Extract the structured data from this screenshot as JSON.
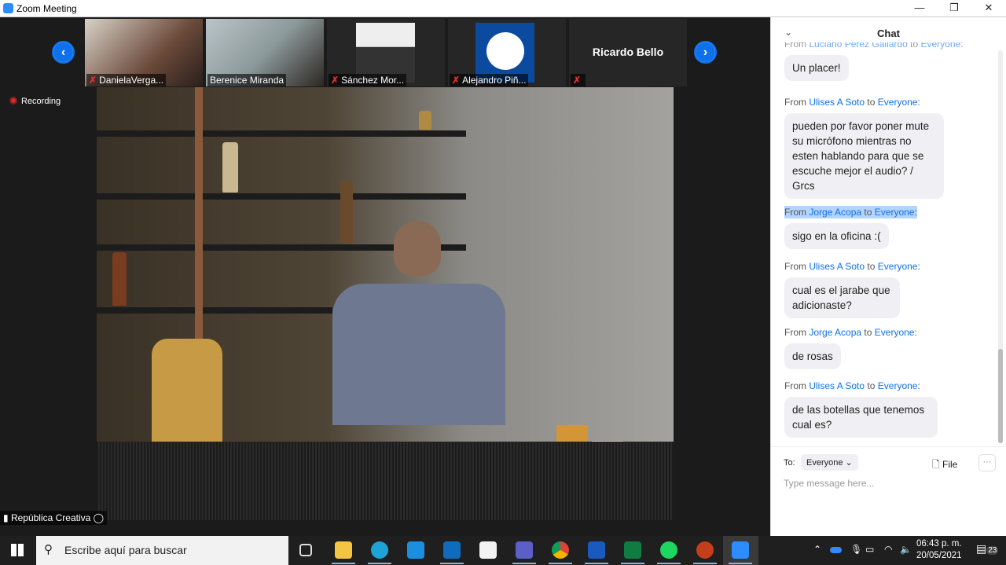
{
  "window": {
    "title": "Zoom Meeting",
    "minimize": "—",
    "restore": "❐",
    "close": "✕"
  },
  "gallery": {
    "participants": [
      {
        "name": "DanielaVerga...",
        "muted": true
      },
      {
        "name": "Berenice Miranda",
        "muted": false
      },
      {
        "name": "Sánchez Mor...",
        "muted": true
      },
      {
        "name": "Alejandro Piñ...",
        "muted": true
      },
      {
        "name": "",
        "display_name": "Ricardo Bello",
        "muted": true
      }
    ],
    "prev": "‹",
    "next": "›"
  },
  "recording": "Recording",
  "active_speaker": "República Creativa",
  "chat": {
    "title": "Chat",
    "collapse": "⌄",
    "messages": [
      {
        "from": "Luciano Pérez Gallardo",
        "to": "Everyone",
        "text": "Un placer!",
        "selected": false
      },
      {
        "from": "Ulises A Soto",
        "to": "Everyone",
        "text": "pueden por favor poner mute su micrófono mientras no esten hablando para que se escuche mejor el audio? / Grcs",
        "selected": false
      },
      {
        "from": "Jorge Acopa",
        "to": "Everyone",
        "text": "sigo en la oficina :(",
        "selected": true
      },
      {
        "from": "Ulises A Soto",
        "to": "Everyone",
        "text": "cual es el jarabe que adicionaste?",
        "selected": false
      },
      {
        "from": "Jorge Acopa",
        "to": "Everyone",
        "text": "de rosas",
        "selected": false
      },
      {
        "from": "Ulises A Soto",
        "to": "Everyone",
        "text": "de las botellas que tenemos cual es?",
        "selected": false
      }
    ],
    "from_label": "From",
    "to_label": "to",
    "to_prefix": "To:",
    "recipient": "Everyone ⌄",
    "file": "File",
    "more": "···",
    "placeholder": "Type message here..."
  },
  "taskbar": {
    "search_placeholder": "Escribe aquí para buscar",
    "apps": [
      "task-view",
      "file-explorer",
      "edge",
      "mail",
      "outlook",
      "store",
      "teams",
      "chrome",
      "word",
      "excel",
      "spotify",
      "powerpoint",
      "zoom"
    ],
    "time": "06:43 p. m.",
    "date": "20/05/2021",
    "notifications": "23"
  },
  "colors": {
    "accent": "#0e71eb",
    "mute": "#e02f2f",
    "recording": "#e02828"
  }
}
